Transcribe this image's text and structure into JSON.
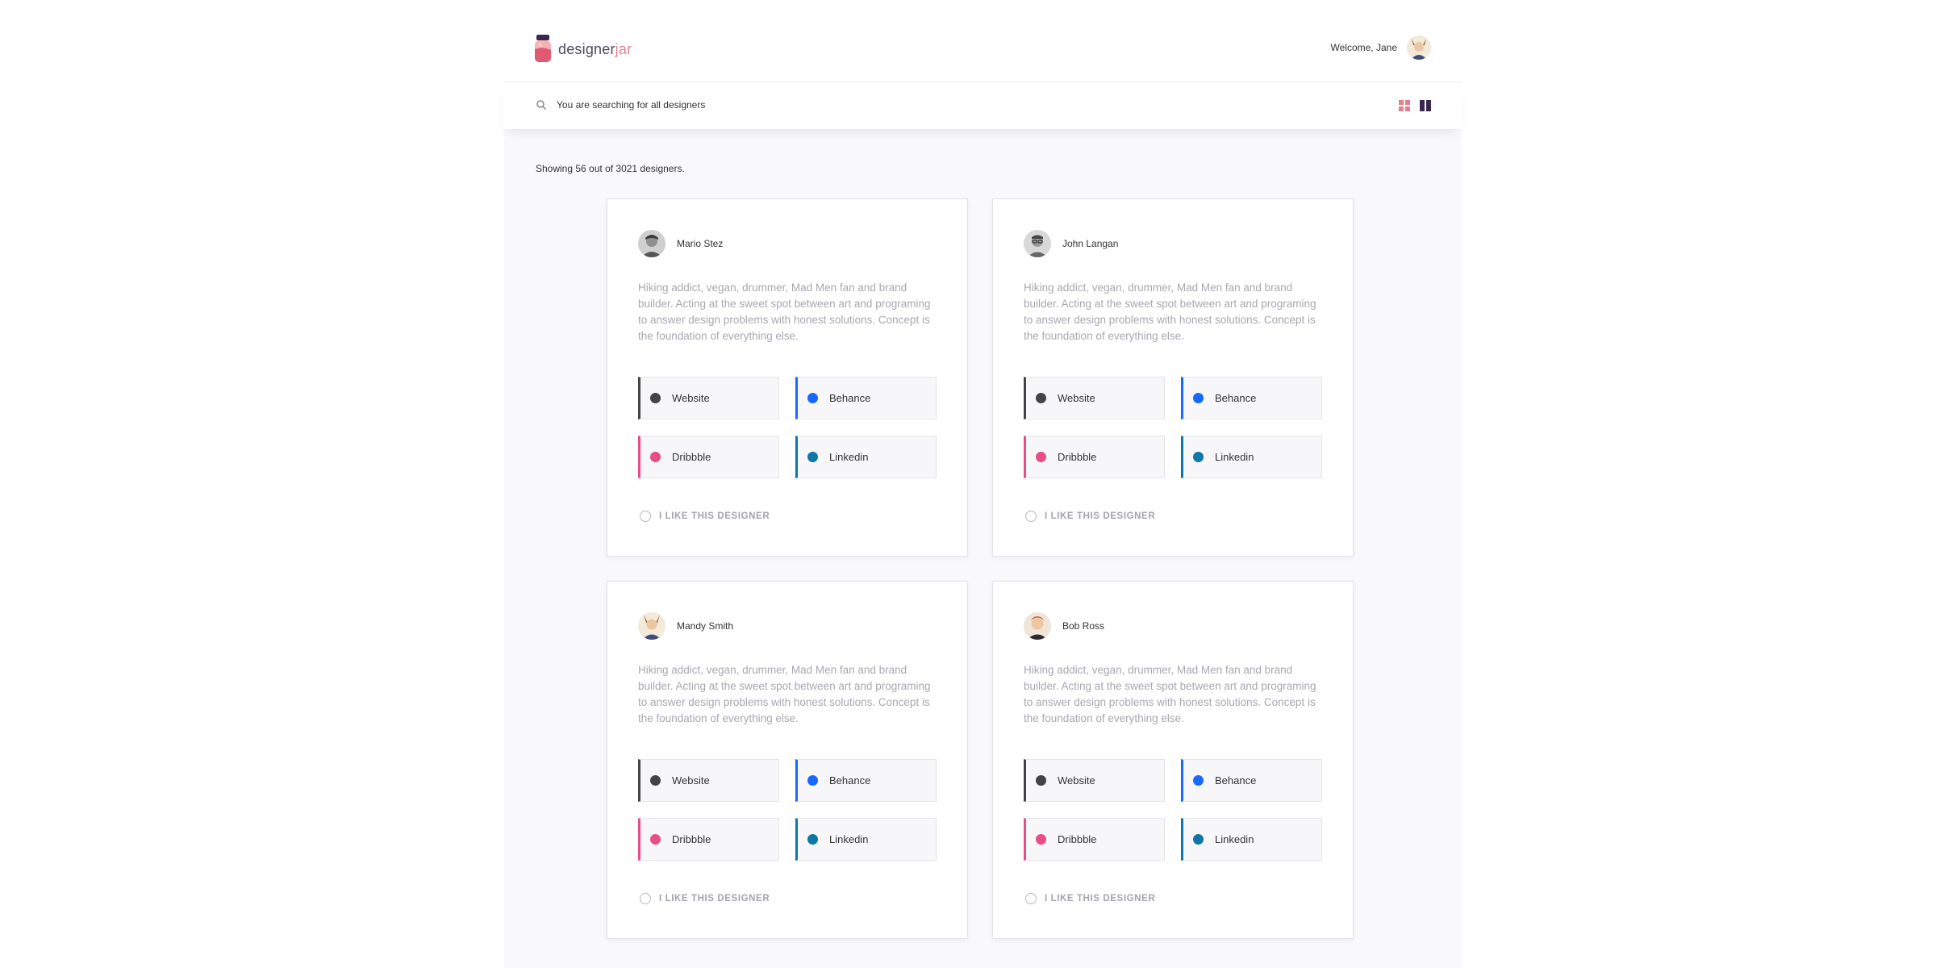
{
  "brand": {
    "name_main": "designer",
    "name_accent": "jar",
    "accent_color": "#e57f8d",
    "logo_icon": "jar-icon"
  },
  "header": {
    "welcome": "Welcome, Jane",
    "user_avatar": "avatar-jane"
  },
  "search": {
    "icon": "search-icon",
    "text": "You are searching for all designers"
  },
  "view_toggle": {
    "grid_icon": "grid-view-icon",
    "grid_color": "#e57f8d",
    "list_icon": "column-view-icon",
    "list_color": "#3a2750"
  },
  "results": {
    "summary": "Showing 56 out of 3021 designers."
  },
  "link_colors": {
    "Website": "#444444",
    "Behance": "#1769ff",
    "Dribbble": "#ea4c89",
    "Linkedin": "#0e76a8"
  },
  "designers": [
    {
      "name": "Mario Stez",
      "bio": "Hiking addict, vegan, drummer, Mad Men fan and brand builder. Acting at the sweet spot between art and programing to answer design problems with honest solutions. Concept is the foundation of everything else.",
      "links": [
        "Website",
        "Behance",
        "Dribbble",
        "Linkedin"
      ],
      "like_label": "I LIKE THIS DESIGNER"
    },
    {
      "name": "John Langan",
      "bio": "Hiking addict, vegan, drummer, Mad Men fan and brand builder. Acting at the sweet spot between art and programing to answer design problems with honest solutions. Concept is the foundation of everything else.",
      "links": [
        "Website",
        "Behance",
        "Dribbble",
        "Linkedin"
      ],
      "like_label": "I LIKE THIS DESIGNER"
    },
    {
      "name": "Mandy Smith",
      "bio": "Hiking addict, vegan, drummer, Mad Men fan and brand builder. Acting at the sweet spot between art and programing to answer design problems with honest solutions. Concept is the foundation of everything else.",
      "links": [
        "Website",
        "Behance",
        "Dribbble",
        "Linkedin"
      ],
      "like_label": "I LIKE THIS DESIGNER"
    },
    {
      "name": "Bob Ross",
      "bio": "Hiking addict, vegan, drummer, Mad Men fan and brand builder. Acting at the sweet spot between art and programing to answer design problems with honest solutions. Concept is the foundation of everything else.",
      "links": [
        "Website",
        "Behance",
        "Dribbble",
        "Linkedin"
      ],
      "like_label": "I LIKE THIS DESIGNER"
    }
  ]
}
